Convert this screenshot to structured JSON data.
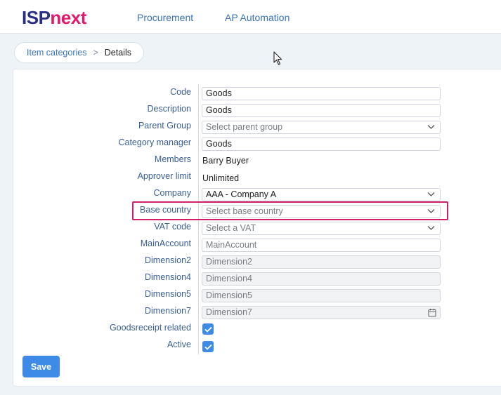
{
  "brand": {
    "part1": "ISP",
    "part2": "next"
  },
  "nav": {
    "procurement": "Procurement",
    "ap_automation": "AP Automation"
  },
  "breadcrumb": {
    "parent": "Item categories",
    "separator": ">",
    "current": "Details"
  },
  "form": {
    "code": {
      "label": "Code",
      "value": "Goods"
    },
    "description": {
      "label": "Description",
      "value": "Goods"
    },
    "parent_group": {
      "label": "Parent Group",
      "placeholder": "Select parent group"
    },
    "category_manager": {
      "label": "Category manager",
      "value": "Goods"
    },
    "members": {
      "label": "Members",
      "value": "Barry Buyer"
    },
    "approver_limit": {
      "label": "Approver limit",
      "value": "Unlimited"
    },
    "company": {
      "label": "Company",
      "value": "AAA - Company A"
    },
    "base_country": {
      "label": "Base country",
      "placeholder": "Select base country"
    },
    "vat_code": {
      "label": "VAT code",
      "placeholder": "Select a VAT"
    },
    "main_account": {
      "label": "MainAccount",
      "placeholder": "MainAccount"
    },
    "dimension2": {
      "label": "Dimension2",
      "placeholder": "Dimension2"
    },
    "dimension4": {
      "label": "Dimension4",
      "placeholder": "Dimension4"
    },
    "dimension5": {
      "label": "Dimension5",
      "placeholder": "Dimension5"
    },
    "dimension7": {
      "label": "Dimension7",
      "placeholder": "Dimension7"
    },
    "goodsreceipt_related": {
      "label": "Goodsreceipt related",
      "checked": true
    },
    "active": {
      "label": "Active",
      "checked": true
    }
  },
  "actions": {
    "save_label": "Save"
  },
  "colors": {
    "brand_dark": "#2b2f8a",
    "brand_accent": "#e0196d",
    "primary": "#3d8be6",
    "highlight": "#d11f6a",
    "link": "#3b74b8"
  }
}
